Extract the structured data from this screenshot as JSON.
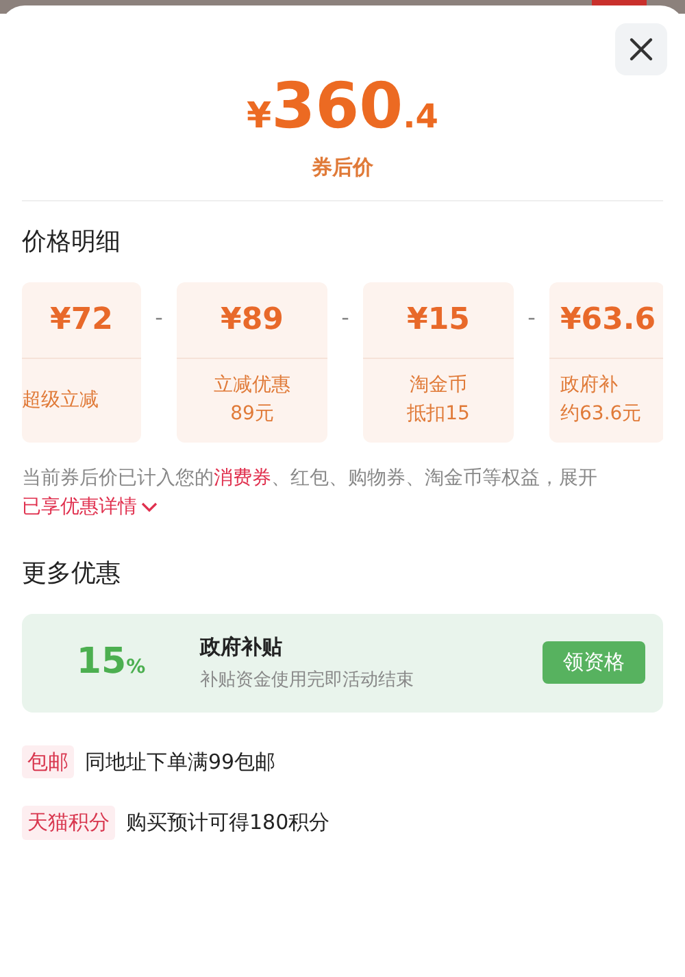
{
  "price": {
    "currency": "¥",
    "integer": "360",
    "decimal": ".4",
    "label": "券后价"
  },
  "breakdown": {
    "title": "价格明细",
    "cards": [
      {
        "amount": "¥72",
        "lines": [
          "超级立减"
        ]
      },
      {
        "separator": "-",
        "amount": "¥89",
        "lines": [
          "立减优惠",
          "89元"
        ]
      },
      {
        "separator": "-",
        "amount": "¥15",
        "lines": [
          "淘金币",
          "抵扣15"
        ]
      },
      {
        "separator": "-",
        "amount": "¥63.6",
        "lines": [
          "政府补",
          "约63.6元"
        ]
      }
    ],
    "notice": [
      {
        "kind": "plain",
        "text": "当前券后价已计入您的"
      },
      {
        "kind": "highlight",
        "text": "消费券"
      },
      {
        "kind": "plain",
        "text": "、红包、购物券、淘金币等权益，展开"
      }
    ],
    "details_link": "已享优惠详情"
  },
  "more_offers": {
    "title": "更多优惠",
    "subsidy": {
      "percent": "15",
      "unit": "%",
      "title": "政府补贴",
      "subtitle": "补贴资金使用完即活动结束",
      "button": "领资格"
    },
    "benefits": [
      {
        "tag": "包邮",
        "text": "同地址下单满99包邮"
      },
      {
        "tag": "天猫积分",
        "text": "购买预计可得180积分"
      }
    ]
  }
}
